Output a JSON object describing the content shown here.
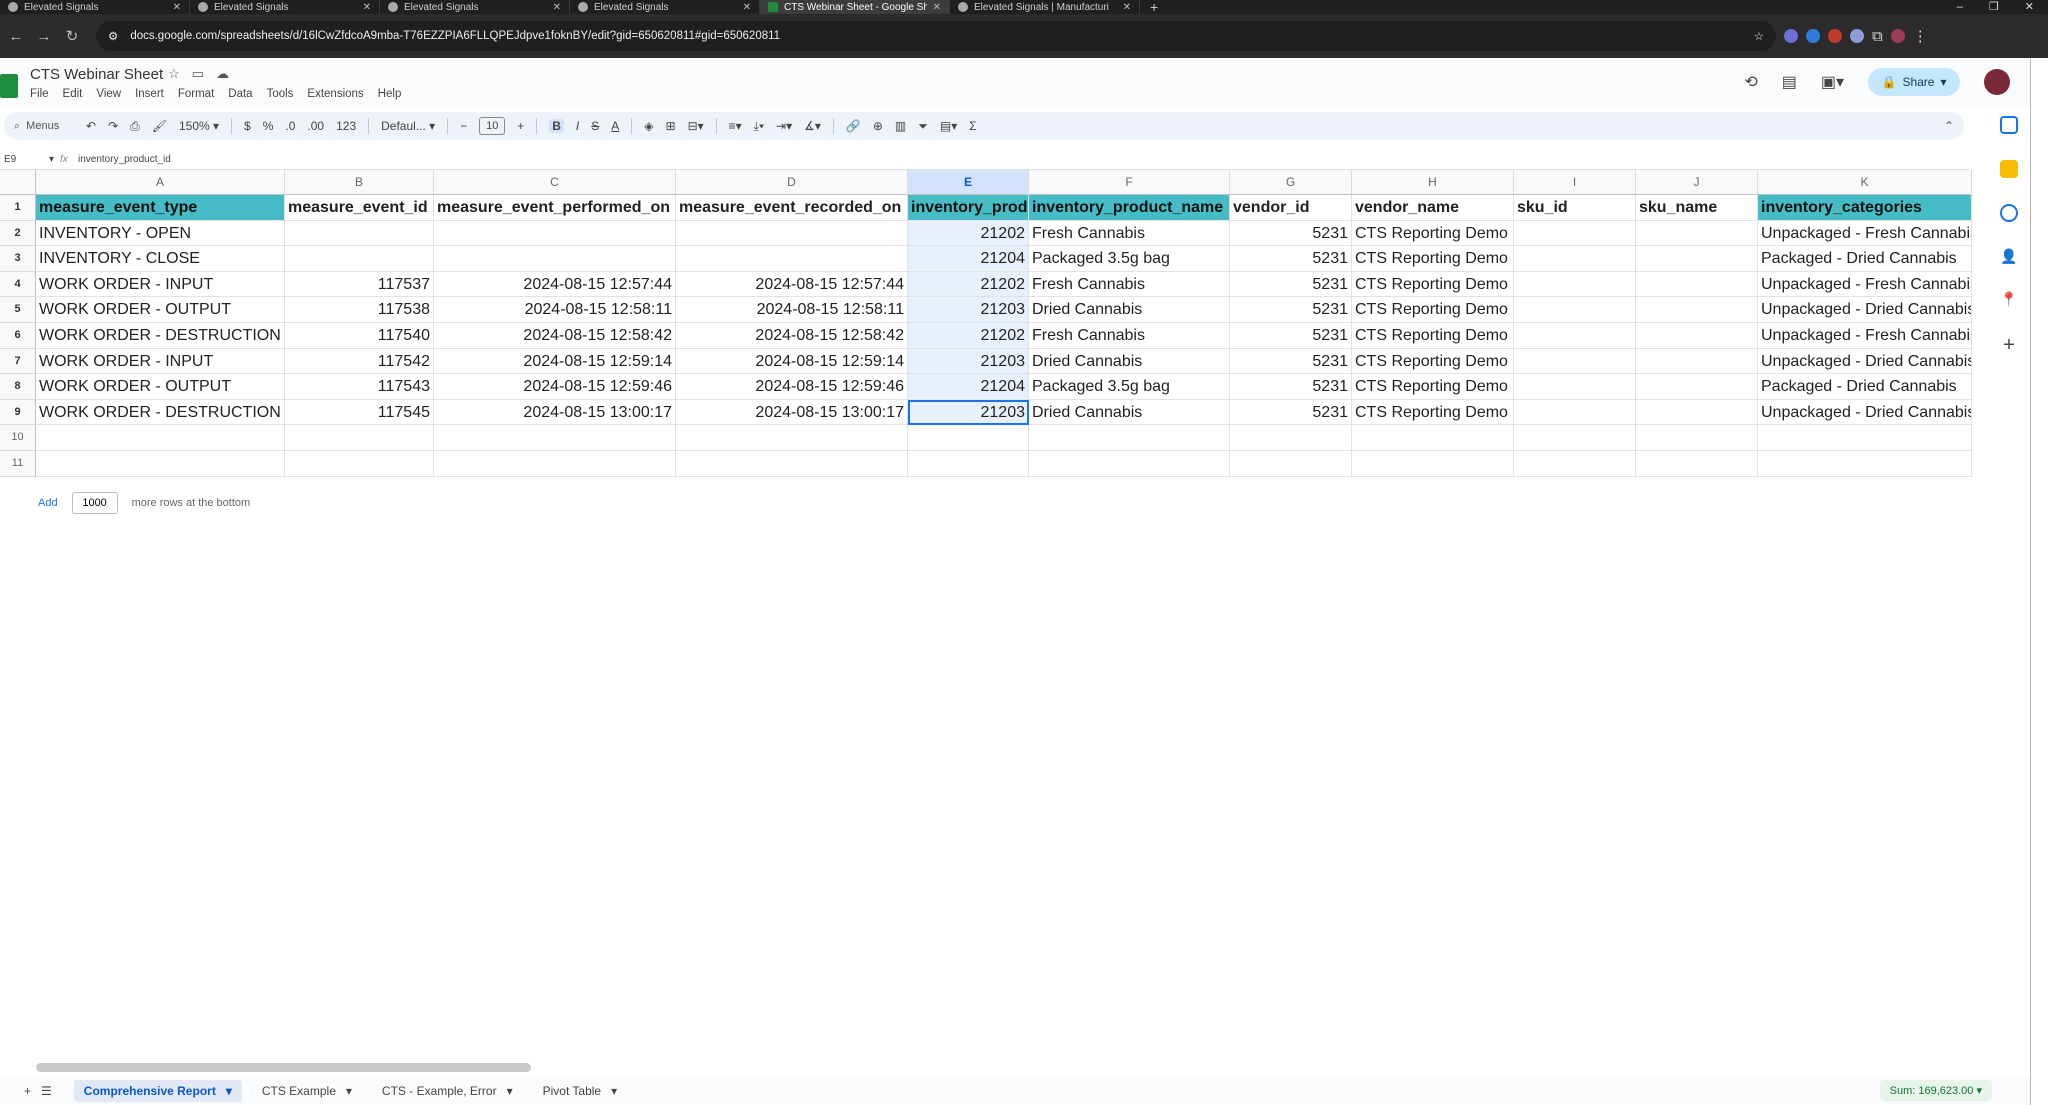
{
  "browser": {
    "tabs": [
      {
        "title": "Elevated Signals"
      },
      {
        "title": "Elevated Signals"
      },
      {
        "title": "Elevated Signals"
      },
      {
        "title": "Elevated Signals"
      },
      {
        "title": "CTS Webinar Sheet - Google Sh"
      },
      {
        "title": "Elevated Signals | Manufacturi"
      }
    ],
    "url": "docs.google.com/spreadsheets/d/16lCwZfdcoA9mba-T76EZZPIA6FLLQPEJdpve1foknBY/edit?gid=650620811#gid=650620811"
  },
  "doc": {
    "title": "CTS Webinar Sheet",
    "menus": [
      "File",
      "Edit",
      "View",
      "Insert",
      "Format",
      "Data",
      "Tools",
      "Extensions",
      "Help"
    ],
    "share_label": "Share"
  },
  "toolbar": {
    "search_label": "Menus",
    "zoom": "150%",
    "currency": "$",
    "percent": "%",
    "dec_decrease": ".0",
    "dec_increase": ".00",
    "numformat": "123",
    "font": "Defaul...",
    "font_size": "10",
    "minus": "−",
    "plus": "+",
    "bold": "B",
    "italic": "I",
    "strike": "S",
    "text_color": "A",
    "sigma": "Σ"
  },
  "formula_bar": {
    "name_box": "E9",
    "content": "inventory_product_id"
  },
  "grid": {
    "columns": [
      {
        "letter": "A"
      },
      {
        "letter": "B"
      },
      {
        "letter": "C"
      },
      {
        "letter": "D"
      },
      {
        "letter": "E"
      },
      {
        "letter": "F"
      },
      {
        "letter": "G"
      },
      {
        "letter": "H"
      },
      {
        "letter": "I"
      },
      {
        "letter": "J"
      },
      {
        "letter": "K"
      }
    ],
    "rows": [
      {
        "num": "1",
        "cells": [
          "measure_event_type",
          "measure_event_id",
          "measure_event_performed_on",
          "measure_event_recorded_on",
          "inventory_prod",
          "inventory_product_name",
          "vendor_id",
          "vendor_name",
          "sku_id",
          "sku_name",
          "inventory_categories"
        ]
      },
      {
        "num": "2",
        "cells": [
          "INVENTORY - OPEN",
          "",
          "",
          "",
          "21202",
          "Fresh Cannabis",
          "5231",
          "CTS Reporting Demo",
          "",
          "",
          "Unpackaged - Fresh Cannabis"
        ]
      },
      {
        "num": "3",
        "cells": [
          "INVENTORY - CLOSE",
          "",
          "",
          "",
          "21204",
          "Packaged 3.5g bag",
          "5231",
          "CTS Reporting Demo",
          "",
          "",
          "Packaged - Dried Cannabis"
        ]
      },
      {
        "num": "4",
        "cells": [
          "WORK ORDER - INPUT",
          "117537",
          "2024-08-15 12:57:44",
          "2024-08-15 12:57:44",
          "21202",
          "Fresh Cannabis",
          "5231",
          "CTS Reporting Demo",
          "",
          "",
          "Unpackaged - Fresh Cannabis"
        ]
      },
      {
        "num": "5",
        "cells": [
          "WORK ORDER - OUTPUT",
          "117538",
          "2024-08-15 12:58:11",
          "2024-08-15 12:58:11",
          "21203",
          "Dried Cannabis",
          "5231",
          "CTS Reporting Demo",
          "",
          "",
          "Unpackaged - Dried Cannabis"
        ]
      },
      {
        "num": "6",
        "cells": [
          "WORK ORDER - DESTRUCTION",
          "117540",
          "2024-08-15 12:58:42",
          "2024-08-15 12:58:42",
          "21202",
          "Fresh Cannabis",
          "5231",
          "CTS Reporting Demo",
          "",
          "",
          "Unpackaged - Fresh Cannabis"
        ]
      },
      {
        "num": "7",
        "cells": [
          "WORK ORDER - INPUT",
          "117542",
          "2024-08-15 12:59:14",
          "2024-08-15 12:59:14",
          "21203",
          "Dried Cannabis",
          "5231",
          "CTS Reporting Demo",
          "",
          "",
          "Unpackaged - Dried Cannabis"
        ]
      },
      {
        "num": "8",
        "cells": [
          "WORK ORDER - OUTPUT",
          "117543",
          "2024-08-15 12:59:46",
          "2024-08-15 12:59:46",
          "21204",
          "Packaged 3.5g bag",
          "5231",
          "CTS Reporting Demo",
          "",
          "",
          "Packaged - Dried Cannabis"
        ]
      },
      {
        "num": "9",
        "cells": [
          "WORK ORDER - DESTRUCTION",
          "117545",
          "2024-08-15 13:00:17",
          "2024-08-15 13:00:17",
          "21203",
          "Dried Cannabis",
          "5231",
          "CTS Reporting Demo",
          "",
          "",
          "Unpackaged - Dried Cannabis"
        ]
      },
      {
        "num": "10",
        "cells": [
          "",
          "",
          "",
          "",
          "",
          "",
          "",
          "",
          "",
          "",
          ""
        ]
      },
      {
        "num": "11",
        "cells": [
          "",
          "",
          "",
          "",
          "",
          "",
          "",
          "",
          "",
          "",
          ""
        ]
      }
    ]
  },
  "add_rows": {
    "button": "Add",
    "value": "1000",
    "suffix": "more rows at the bottom"
  },
  "sheets": {
    "tabs": [
      {
        "label": "Comprehensive Report",
        "active": true
      },
      {
        "label": "CTS Example",
        "active": false
      },
      {
        "label": "CTS - Example, Error",
        "active": false
      },
      {
        "label": "Pivot Table",
        "active": false
      }
    ],
    "sum": "Sum: 169,623.00"
  },
  "colors": {
    "header_fill": "#46bdc6",
    "selection_blue": "#1a73e8",
    "share_button": "#c2e7ff"
  }
}
